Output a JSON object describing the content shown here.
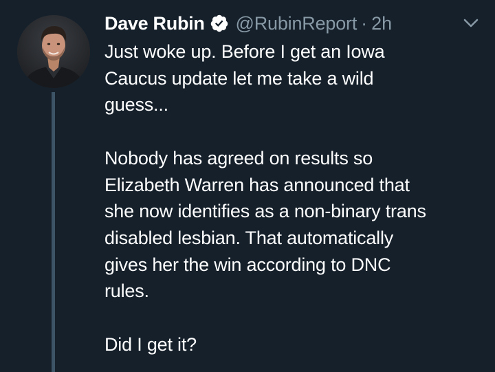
{
  "tweet": {
    "author": {
      "display_name": "Dave Rubin",
      "handle": "@RubinReport",
      "verified_icon": "verified-badge-icon",
      "avatar_icon": "user-avatar-photo"
    },
    "separator": "·",
    "timestamp": "2h",
    "menu_icon": "chevron-down-icon",
    "paragraphs": [
      "Just woke up. Before I get an Iowa\nCaucus update let me take a wild\nguess...",
      "Nobody has agreed on results so\nElizabeth Warren has announced that\nshe now identifies as a non-binary trans\ndisabled lesbian. That automatically\ngives her the win according to DNC\nrules.",
      "Did I get it?"
    ]
  },
  "colors": {
    "background": "#15202b",
    "text_primary": "#ffffff",
    "text_secondary": "#8899a6",
    "thread_line": "#3d5466"
  }
}
